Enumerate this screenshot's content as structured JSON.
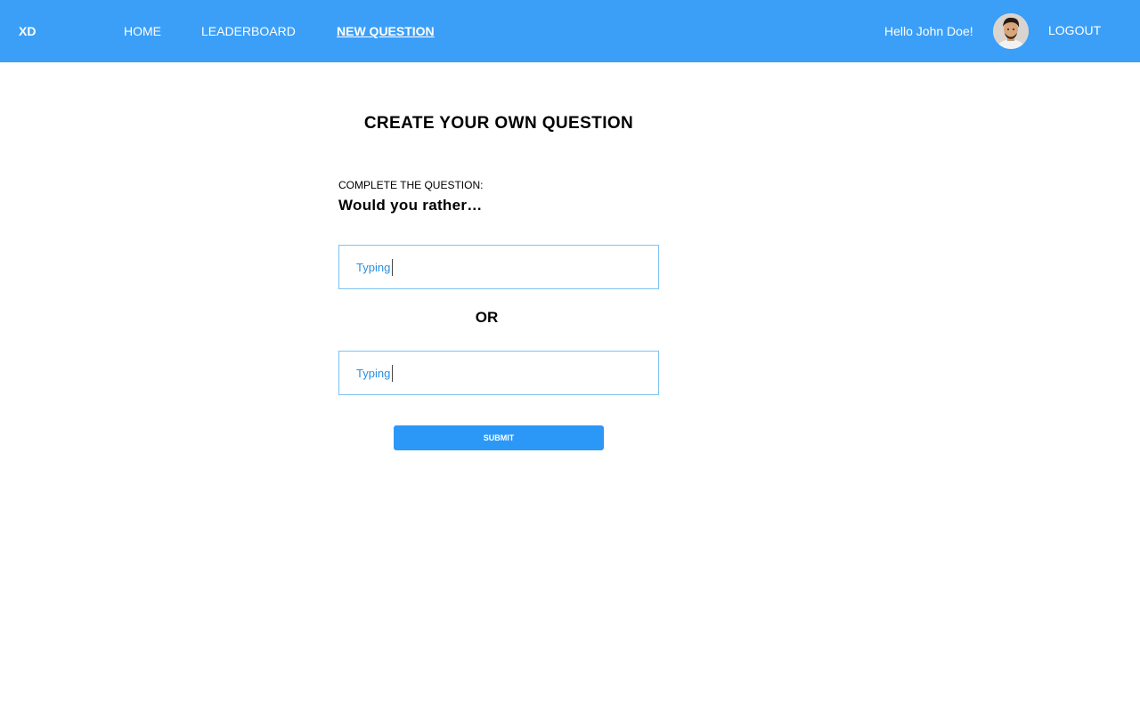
{
  "navbar": {
    "brand": "XD",
    "links": [
      {
        "label": "HOME"
      },
      {
        "label": "LEADERBOARD"
      },
      {
        "label": "NEW QUESTION",
        "active": true
      }
    ],
    "greeting": "Hello John Doe!",
    "logout_label": "LOGOUT",
    "avatar": "user-avatar-photo",
    "color": "#3b9ff8"
  },
  "main": {
    "title": "CREATE YOUR OWN QUESTION",
    "instruction": "COMPLETE THE QUESTION:",
    "prompt": "Would you rather…",
    "option_one": {
      "value": "Typing"
    },
    "separator": "OR",
    "option_two": {
      "value": "Typing"
    },
    "submit_label": "SUBMIT"
  },
  "colors": {
    "accent": "#2b98f7",
    "input_border": "#7cc3f2",
    "input_text": "#2a8fe0"
  }
}
